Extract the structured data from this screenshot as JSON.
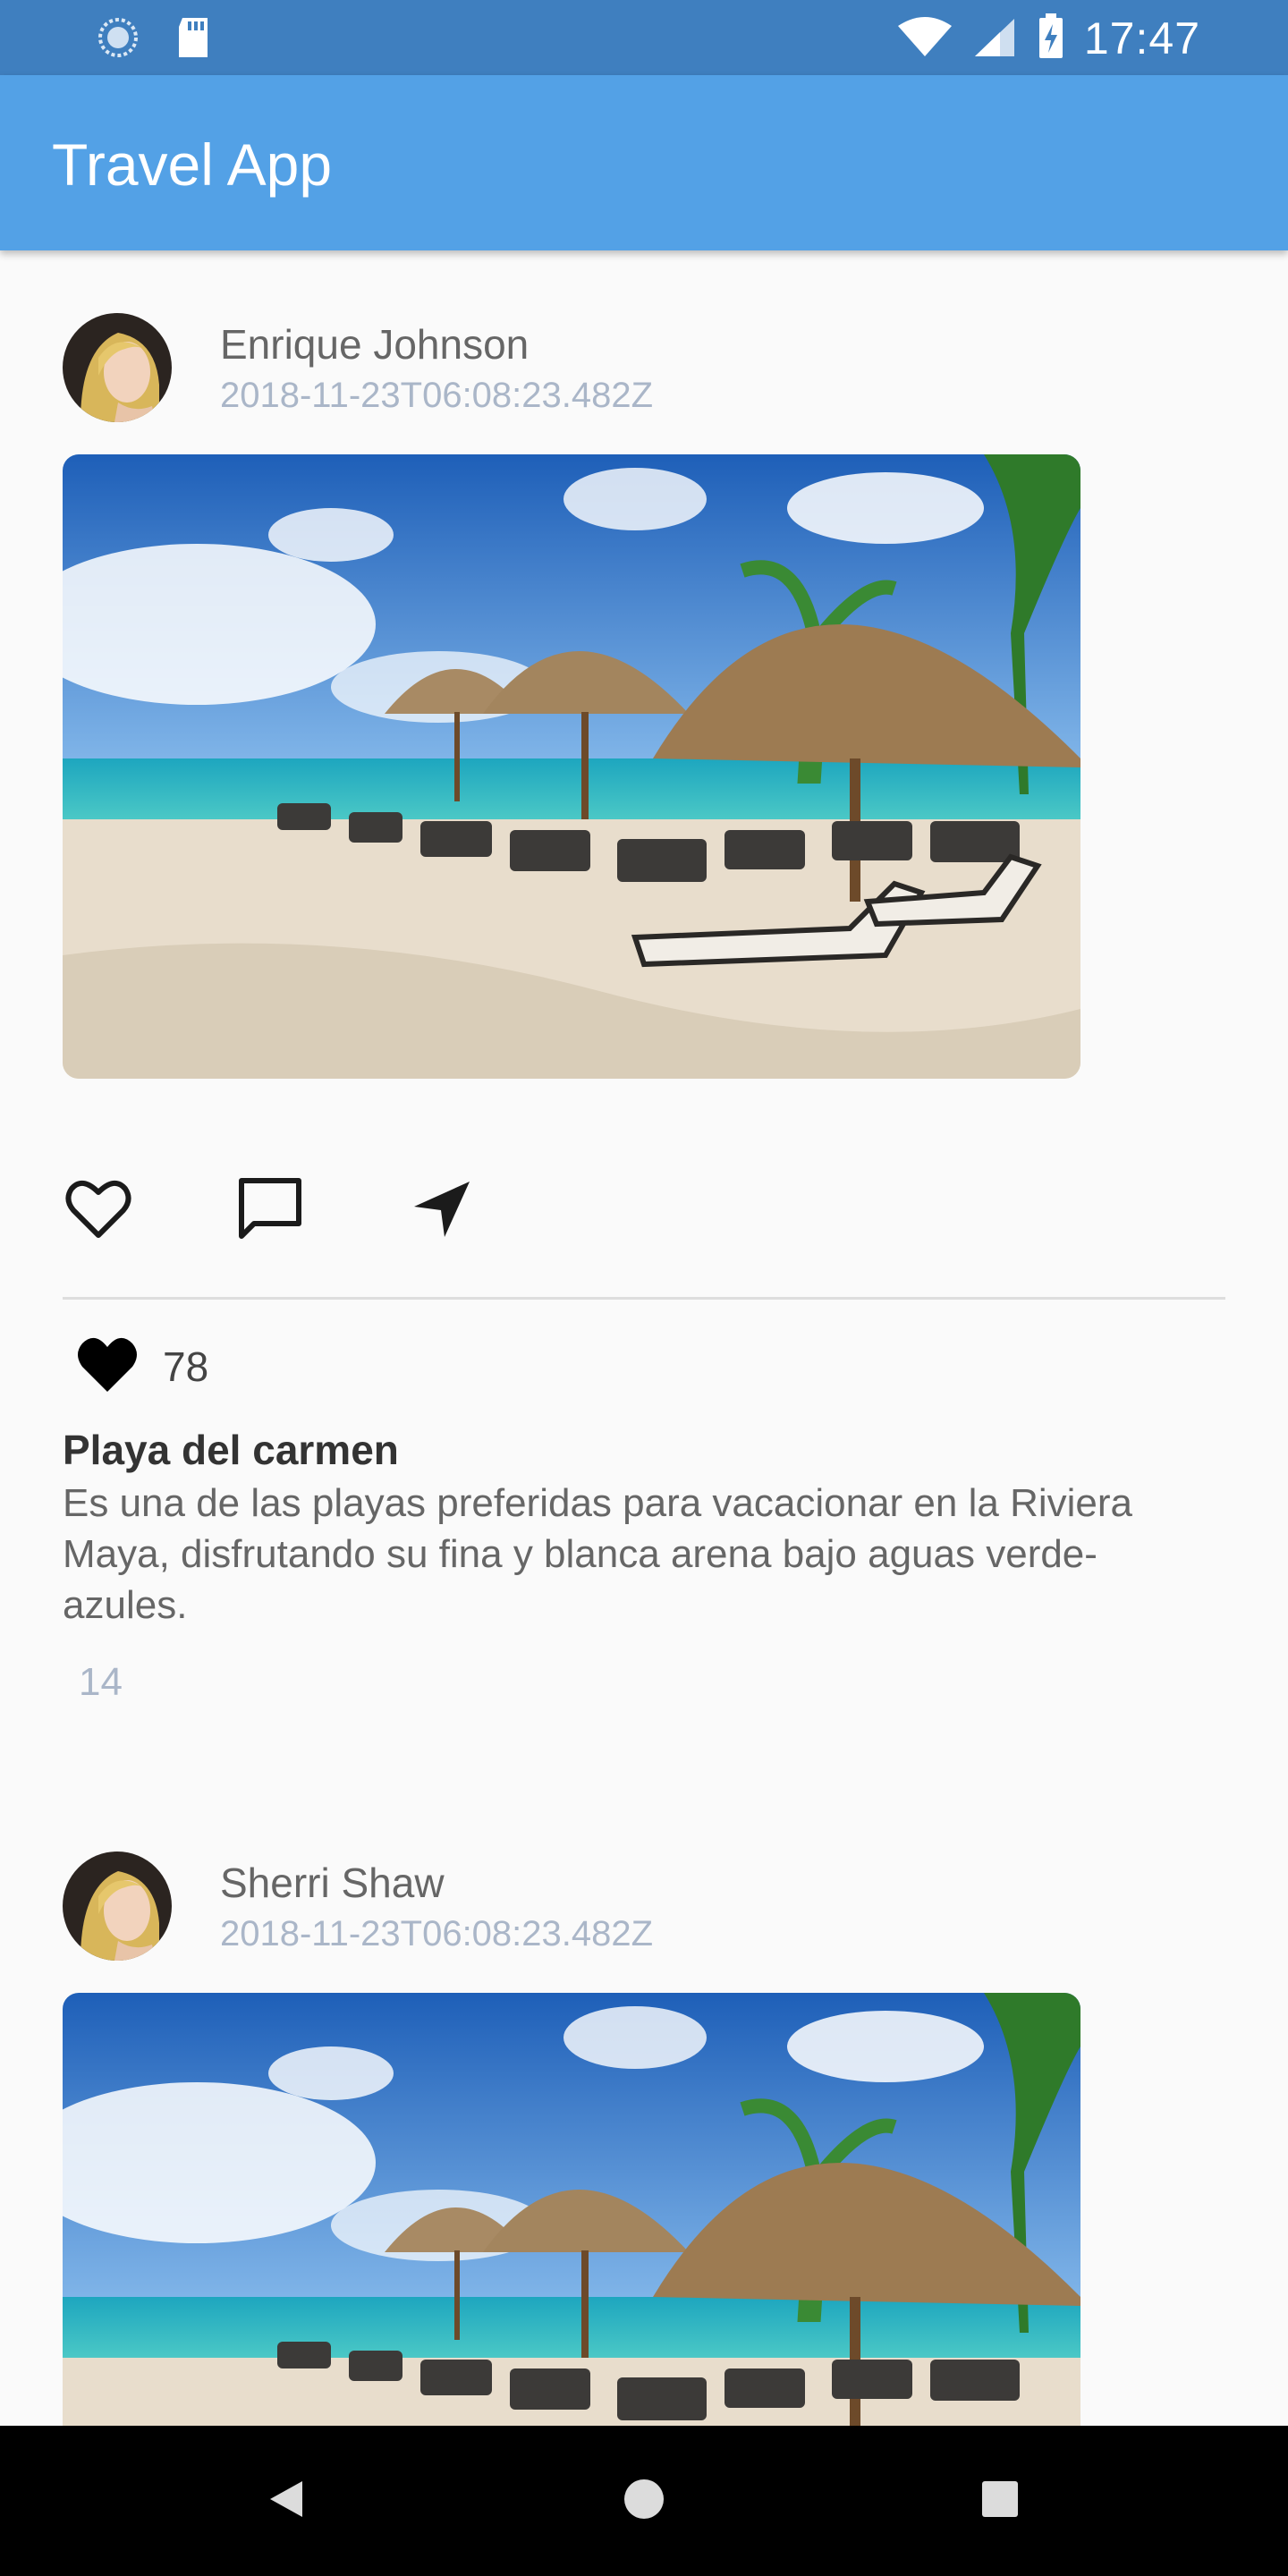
{
  "status_bar": {
    "time": "17:47",
    "icons": [
      "sync-icon",
      "sd-card-icon",
      "wifi-icon",
      "signal-icon",
      "battery-charging-icon"
    ]
  },
  "app_bar": {
    "title": "Travel App"
  },
  "posts": [
    {
      "author": "Enrique Johnson",
      "timestamp": "2018-11-23T06:08:23.482Z",
      "likes": "78",
      "title": "Playa del carmen",
      "description": "Es una de las playas preferidas para vacacionar en la Riviera Maya, disfrutando su  fina y blanca arena bajo aguas verde-azules.",
      "comments": "14"
    },
    {
      "author": "Sherri Shaw",
      "timestamp": "2018-11-23T06:08:23.482Z"
    }
  ],
  "action_icons": [
    "heart-outline-icon",
    "comment-icon",
    "send-icon"
  ],
  "nav_bar": {
    "icons": [
      "back-icon",
      "home-icon",
      "recents-icon"
    ]
  },
  "colors": {
    "status_bar": "#3f7fbf",
    "app_bar": "#53a1e6",
    "background": "#fafafa",
    "timestamp": "#aab6c8"
  }
}
